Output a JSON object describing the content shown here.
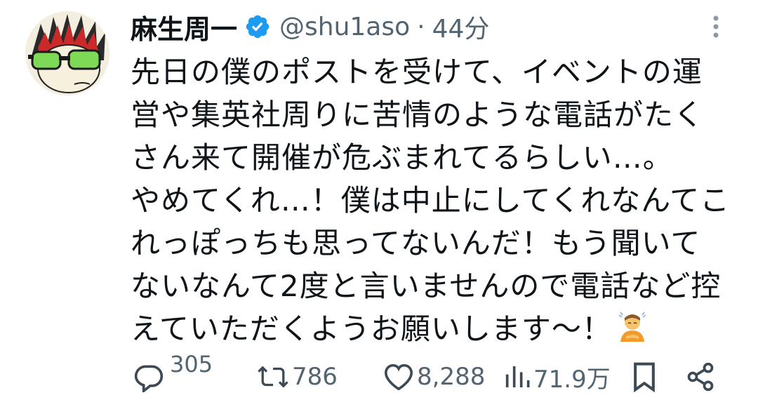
{
  "author": {
    "display_name": "麻生周一",
    "handle": "@shu1aso",
    "separator": "·",
    "time": "44分",
    "verified": true,
    "verified_color": "#1d9bf0"
  },
  "post": {
    "lines": [
      "先日の僕のポストを受けて、イベントの運",
      "営や集英社周りに苦情のような電話がたく",
      "さん来て開催が危ぶまれてるらしい…。",
      "やめてくれ…！僕は中止にしてくれなんてこ",
      "れっぽっちも思ってないんだ！もう聞いて",
      "ないなんて2度と言いませんので電話など控",
      "えていただくようお願いします〜！"
    ],
    "trailing_emoji": "person-bowing-emoji"
  },
  "actions": {
    "reply_count": "305",
    "retweet_count": "786",
    "like_count": "8,288",
    "view_count": "71.9万"
  },
  "icons": {
    "more": "more-vertical-icon",
    "reply": "reply-icon",
    "retweet": "retweet-icon",
    "like": "heart-icon",
    "views": "views-icon",
    "bookmark": "bookmark-icon",
    "share": "share-icon"
  },
  "colors": {
    "text": "#0f1419",
    "secondary": "#536471",
    "verified": "#1d9bf0"
  }
}
